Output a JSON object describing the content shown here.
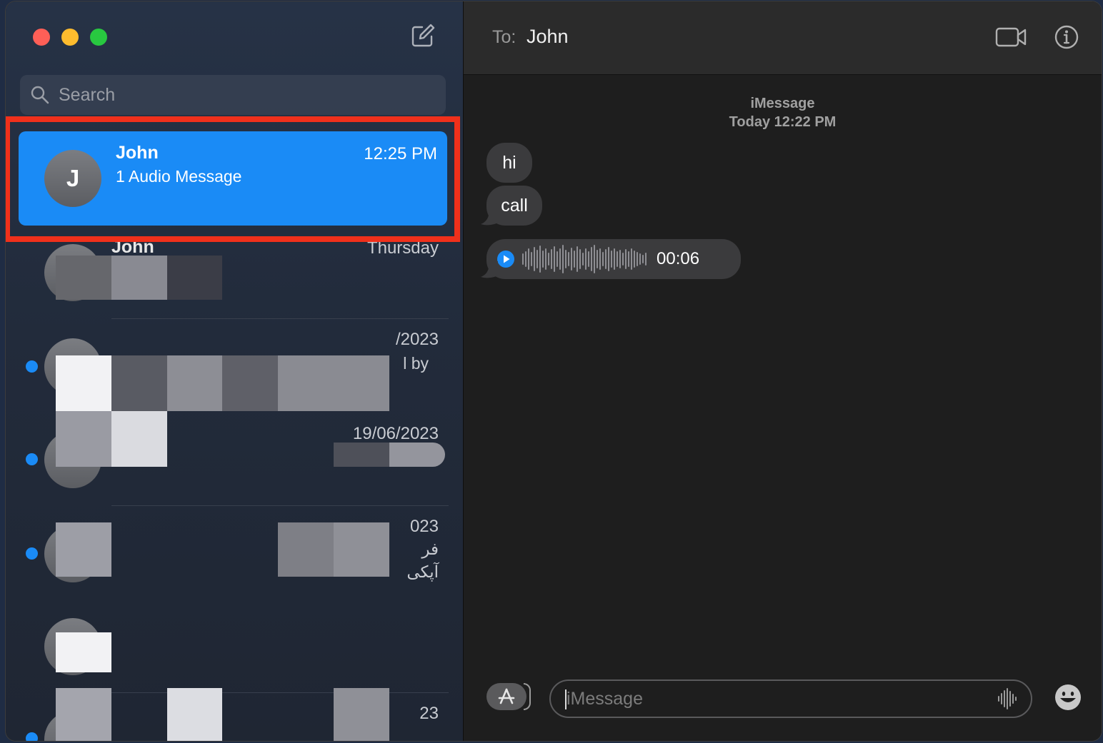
{
  "sidebar": {
    "search_placeholder": "Search",
    "conversations": [
      {
        "name": "John",
        "time": "12:25 PM",
        "preview": "1 Audio Message",
        "avatar_initial": "J",
        "selected": true
      },
      {
        "name": "John",
        "time": "Thursday"
      },
      {
        "time": "/2023",
        "preview": "l by"
      },
      {
        "time": "19/06/2023"
      },
      {
        "time": "023",
        "preview_line1": "فر",
        "preview_line2": "آپکی"
      },
      {
        "time": "23"
      }
    ]
  },
  "chat": {
    "to_label": "To:",
    "recipient": "John",
    "service": "iMessage",
    "timestamp": "Today 12:22 PM",
    "messages": [
      {
        "type": "text",
        "text": "hi"
      },
      {
        "type": "text",
        "text": "call"
      },
      {
        "type": "audio",
        "duration": "00:06"
      }
    ],
    "input_placeholder": "iMessage"
  },
  "colors": {
    "accent": "#1a8bf6",
    "highlight_border": "#f0301b",
    "bubble": "#3b3b3d"
  },
  "icons": [
    "compose-icon",
    "search-icon",
    "video-call-icon",
    "info-icon",
    "play-icon",
    "app-store-icon",
    "dictation-icon",
    "emoji-icon"
  ]
}
